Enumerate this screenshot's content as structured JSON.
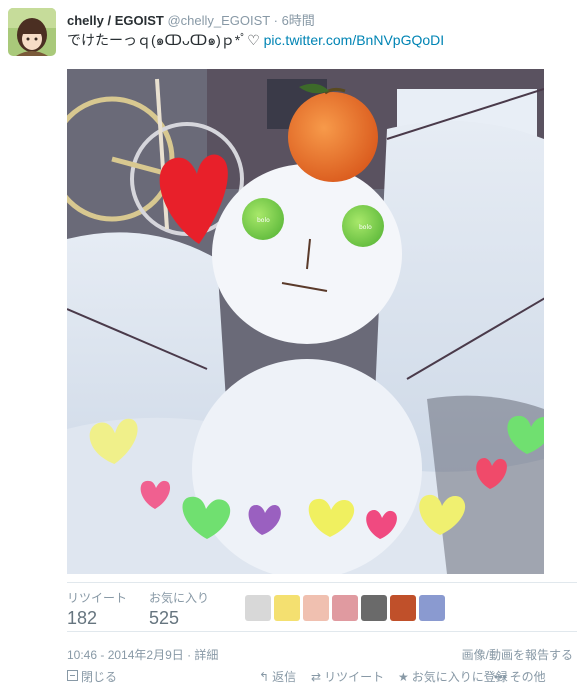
{
  "tweet": {
    "fullname": "chelly / EGOIST",
    "username": "@chelly_EGOIST",
    "separator": "·",
    "time_ago": "6時間",
    "text": "でけたーっｑ(๑ↀᴗↀ๑)ｐ*ﾟ♡ ",
    "link": "pic.twitter.com/BnNVpGQoDI"
  },
  "stats": {
    "retweet_label": "リツイート",
    "retweet_count": "182",
    "favorite_label": "お気に入り",
    "favorite_count": "525"
  },
  "footer": {
    "timestamp": "10:46 - 2014年2月9日 · 詳細",
    "report": "画像/動画を報告する"
  },
  "actions": {
    "close": "閉じる",
    "reply": "返信",
    "retweet": "リツイート",
    "favorite": "お気に入りに登録",
    "more": "その他"
  },
  "icons": {
    "close": "close-icon",
    "reply": "reply-icon",
    "retweet": "retweet-icon",
    "favorite": "star-icon",
    "more": "more-dots-icon"
  },
  "colors": {
    "link": "#0084b4",
    "meta": "#8899a6",
    "text": "#292f33"
  }
}
